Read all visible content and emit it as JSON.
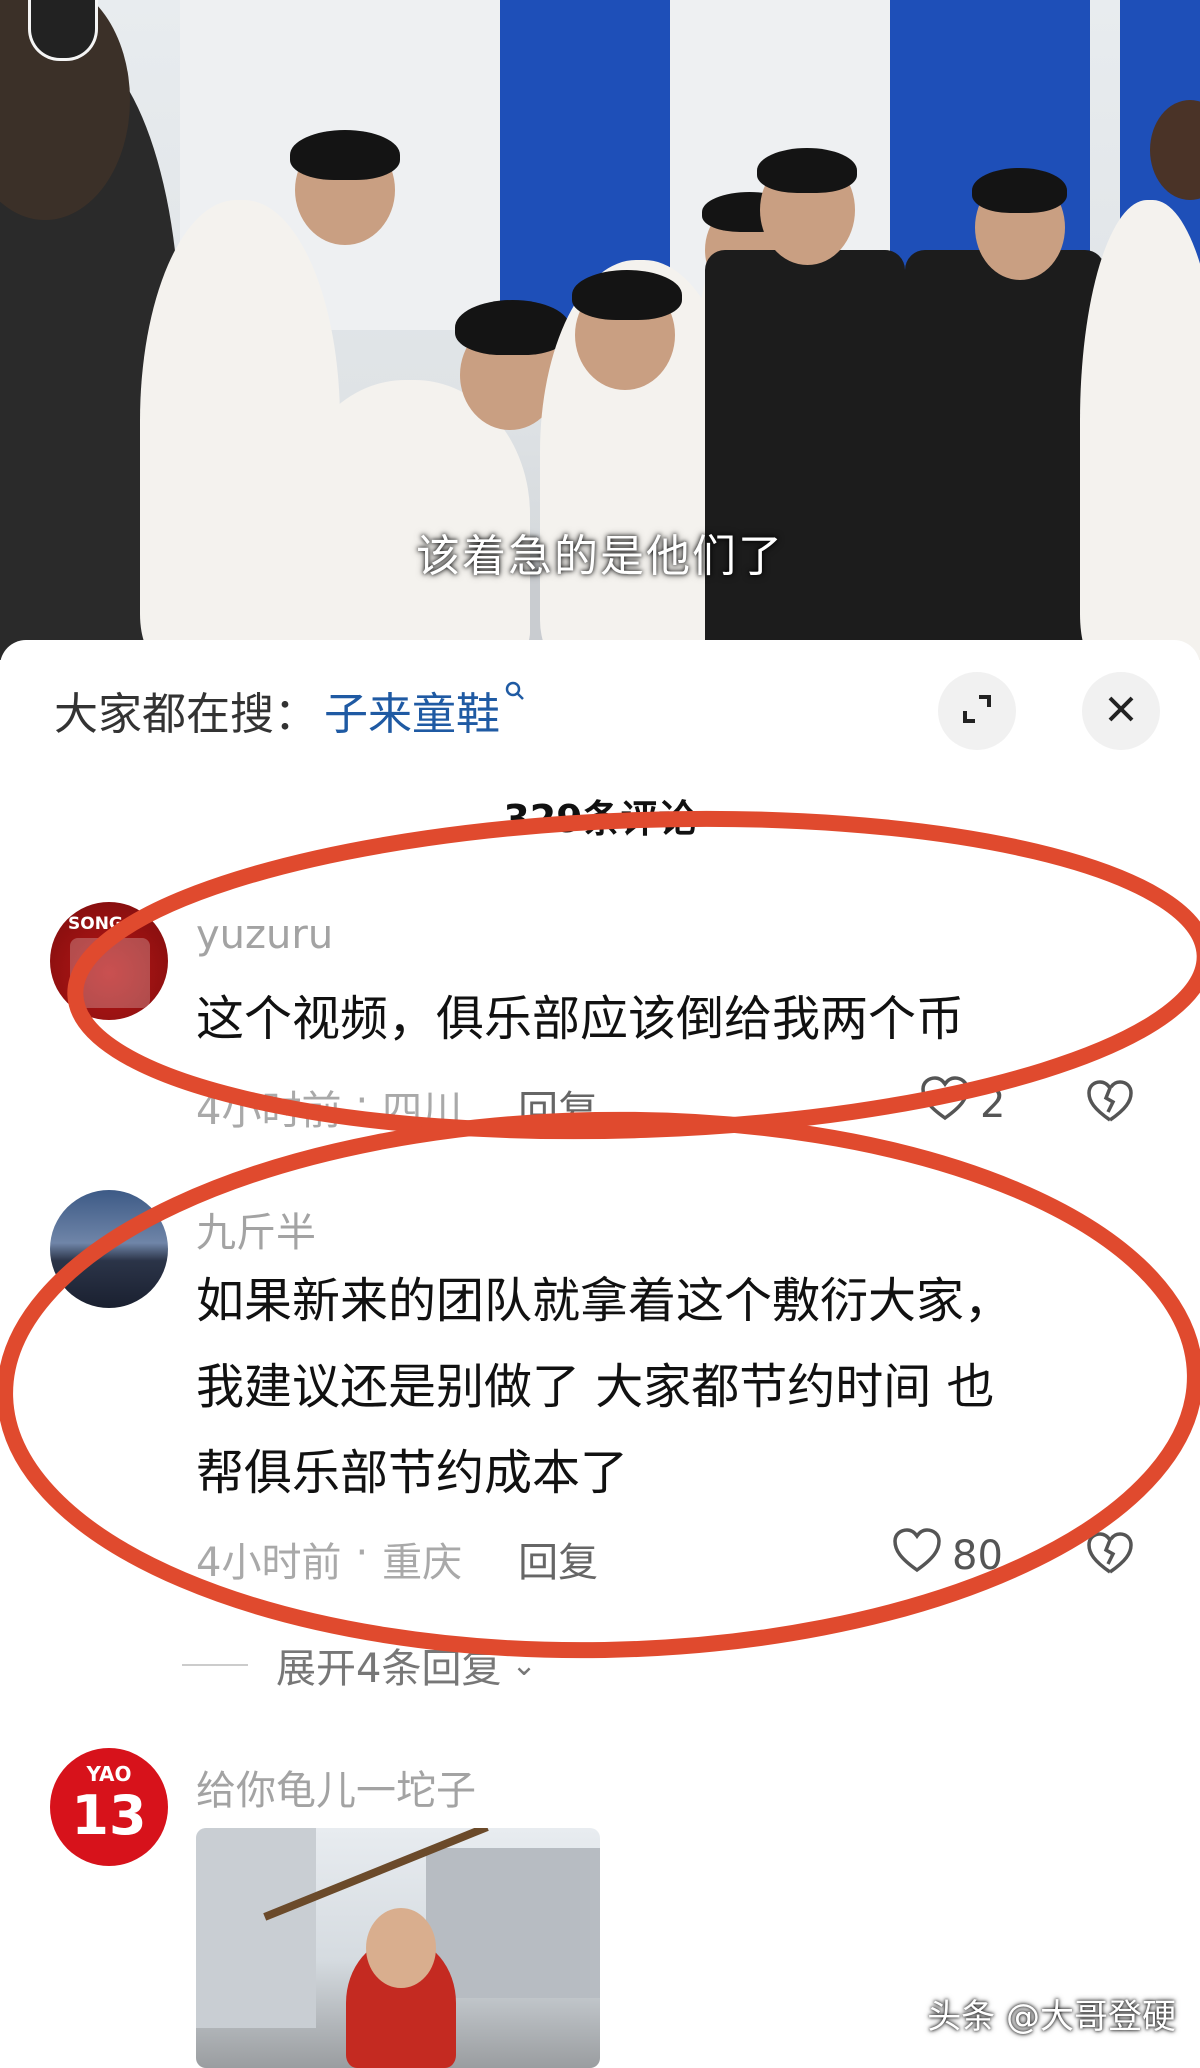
{
  "video": {
    "subtitle": "该着急的是他们了"
  },
  "search": {
    "prefix": "大家都在搜：",
    "term": "子来童鞋"
  },
  "comments_header": {
    "count": "329条评论"
  },
  "comments": [
    {
      "username": "yuzuru",
      "avatar_text": "SONG P",
      "text": "这个视频，俱乐部应该倒给我两个币",
      "time": "4小时前",
      "location": "四川",
      "reply_label": "回复",
      "likes": "2"
    },
    {
      "username": "九斤半",
      "text_lines": [
        "如果新来的团队就拿着这个敷衍大家，",
        "我建议还是别做了 大家都节约时间 也",
        "帮俱乐部节约成本了"
      ],
      "time": "4小时前",
      "location": "重庆",
      "reply_label": "回复",
      "likes": "80",
      "expand_label": "展开4条回复"
    },
    {
      "username": "给你龟儿一坨子",
      "avatar_text_top": "YAO",
      "avatar_number": "13"
    }
  ],
  "watermark": "头条 @大哥登硬",
  "colors": {
    "accent_link": "#1f5aa3",
    "annotation_ring": "#e04a2e",
    "avatar_red": "#d7121b"
  },
  "icons": [
    "expand-icon",
    "close-icon",
    "heart-icon",
    "dislike-icon",
    "search-icon"
  ]
}
